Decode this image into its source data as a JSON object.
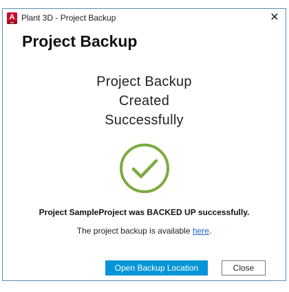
{
  "window": {
    "title": "Plant 3D - Project Backup",
    "app_icon_letter": "A",
    "app_icon_sub": "P3D",
    "close_glyph": "✕"
  },
  "dialog": {
    "heading": "Project Backup",
    "message_lines": [
      "Project Backup",
      "Created",
      "Successfully"
    ],
    "status_icon": "check-circle-icon",
    "success_text": "Project SampleProject was BACKED UP successfully.",
    "available_prefix": "The project backup is available ",
    "available_link": "here",
    "available_suffix": "."
  },
  "buttons": {
    "open_location": "Open Backup Location",
    "close": "Close"
  },
  "colors": {
    "accent": "#0696d7",
    "success": "#7aab3f",
    "link": "#1d5fc2",
    "app_icon": "#c8102e"
  }
}
